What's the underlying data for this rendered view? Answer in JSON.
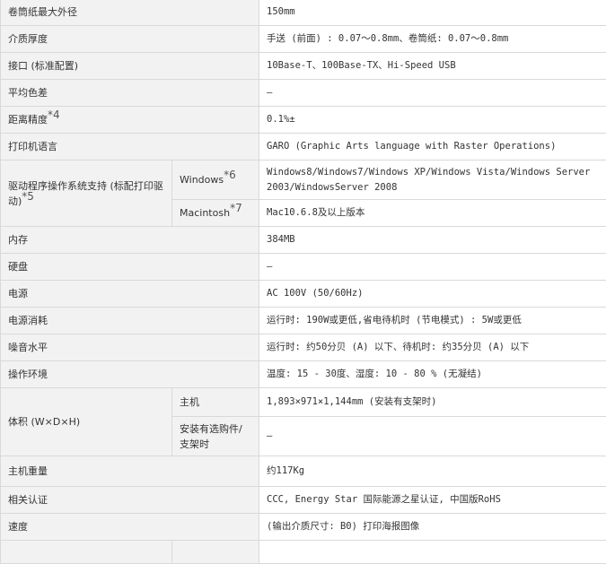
{
  "rows": {
    "r1": {
      "label": "卷筒纸最大外径",
      "value": "150mm"
    },
    "r2": {
      "label": "介质厚度",
      "value": "手送 (前面) : 0.07～0.8mm、卷筒纸: 0.07～0.8mm"
    },
    "r3": {
      "label": "接口 (标准配置)",
      "value": "10Base-T、100Base-TX、Hi-Speed USB"
    },
    "r4": {
      "label": "平均色差",
      "value": "–"
    },
    "r5": {
      "label": "距离精度",
      "note": "*4",
      "value": "0.1%±"
    },
    "r6": {
      "label": "打印机语言",
      "value": "GARO (Graphic Arts language with Raster Operations)"
    },
    "r7": {
      "label": "驱动程序操作系统支持 (标配打印驱动)",
      "note": "*5",
      "subs": [
        {
          "label": "Windows",
          "note": "*6",
          "value": "Windows8/Windows7/Windows XP/Windows Vista/Windows Server 2003/WindowsServer 2008"
        },
        {
          "label": "Macintosh",
          "note": "*7",
          "value": "Mac10.6.8及以上版本"
        }
      ]
    },
    "r8": {
      "label": "内存",
      "value": "384MB"
    },
    "r9": {
      "label": "硬盘",
      "value": "–"
    },
    "r10": {
      "label": "电源",
      "value": "AC 100V (50/60Hz)"
    },
    "r11": {
      "label": "电源消耗",
      "value": "运行时: 190W或更低,省电待机时 (节电模式) : 5W或更低"
    },
    "r12": {
      "label": "噪音水平",
      "value": "运行时: 约50分贝 (A) 以下、待机时: 约35分贝 (A) 以下"
    },
    "r13": {
      "label": "操作环境",
      "value": "温度: 15 - 30度、湿度: 10 - 80 % (无凝结)"
    },
    "r14": {
      "label": "体积 (W×D×H)",
      "subs": [
        {
          "label": "主机",
          "value": "1,893×971×1,144mm (安装有支架时)"
        },
        {
          "label": "安装有选购件/支架时",
          "value": "–"
        }
      ]
    },
    "r15": {
      "label": "主机重量",
      "value": "约117Kg"
    },
    "r16": {
      "label": "相关认证",
      "value": "CCC, Energy Star 国际能源之星认证, 中国版RoHS"
    },
    "r17": {
      "label": "速度",
      "value": "(输出介质尺寸: B0) 打印海报图像"
    }
  }
}
